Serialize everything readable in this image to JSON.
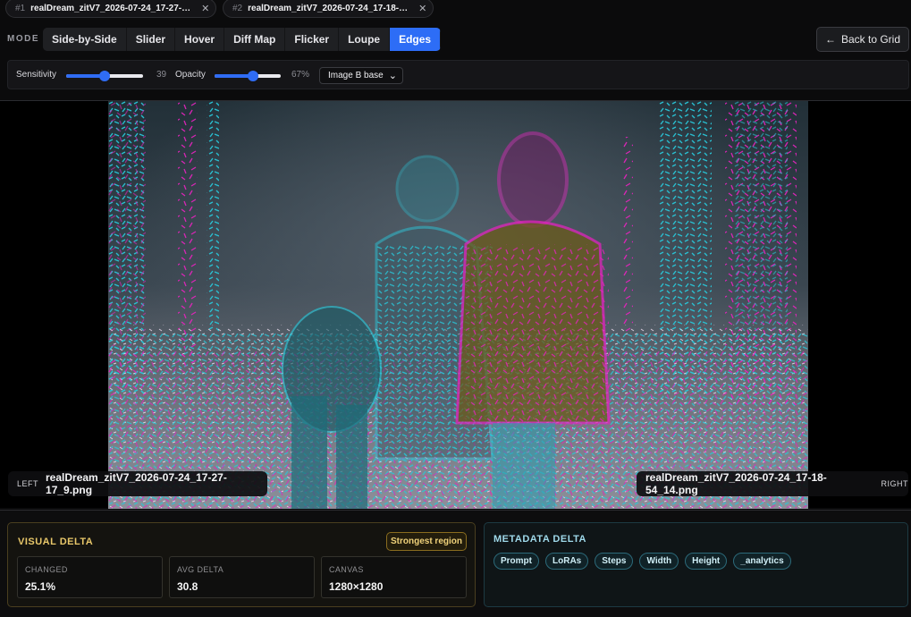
{
  "tabs": [
    {
      "num": "#1",
      "name": "realDream_zitV7_2026-07-24_17-27-…"
    },
    {
      "num": "#2",
      "name": "realDream_zitV7_2026-07-24_17-18-…"
    }
  ],
  "mode": {
    "label": "MODE",
    "buttons": [
      "Side-by-Side",
      "Slider",
      "Hover",
      "Diff Map",
      "Flicker",
      "Loupe",
      "Edges"
    ],
    "active": "Edges"
  },
  "back_button": "Back to Grid",
  "controls": {
    "sensitivity": {
      "label": "Sensitivity",
      "value": 39,
      "display": "39",
      "fraction": 0.5
    },
    "opacity": {
      "label": "Opacity",
      "value": 67,
      "display": "67%",
      "fraction": 0.58
    },
    "base_select": "Image B base"
  },
  "left_file": {
    "side": "LEFT",
    "name": "realDream_zitV7_2026-07-24_17-27-17_9.png"
  },
  "right_file": {
    "side": "RIGHT",
    "name": "realDream_zitV7_2026-07-24_17-18-54_14.png"
  },
  "visual_delta": {
    "title": "VISUAL DELTA",
    "badge": "Strongest region",
    "stats": [
      {
        "label": "CHANGED",
        "value": "25.1%"
      },
      {
        "label": "AVG DELTA",
        "value": "30.8"
      },
      {
        "label": "CANVAS",
        "value": "1280×1280"
      }
    ]
  },
  "metadata_delta": {
    "title": "METADATA DELTA",
    "chips": [
      "Prompt",
      "LoRAs",
      "Steps",
      "Width",
      "Height",
      "_analytics"
    ]
  },
  "colors": {
    "accent": "#2d6df6",
    "edge_cyan": "#27c4d6",
    "edge_magenta": "#e021b8",
    "gold": "#e9c86a"
  }
}
